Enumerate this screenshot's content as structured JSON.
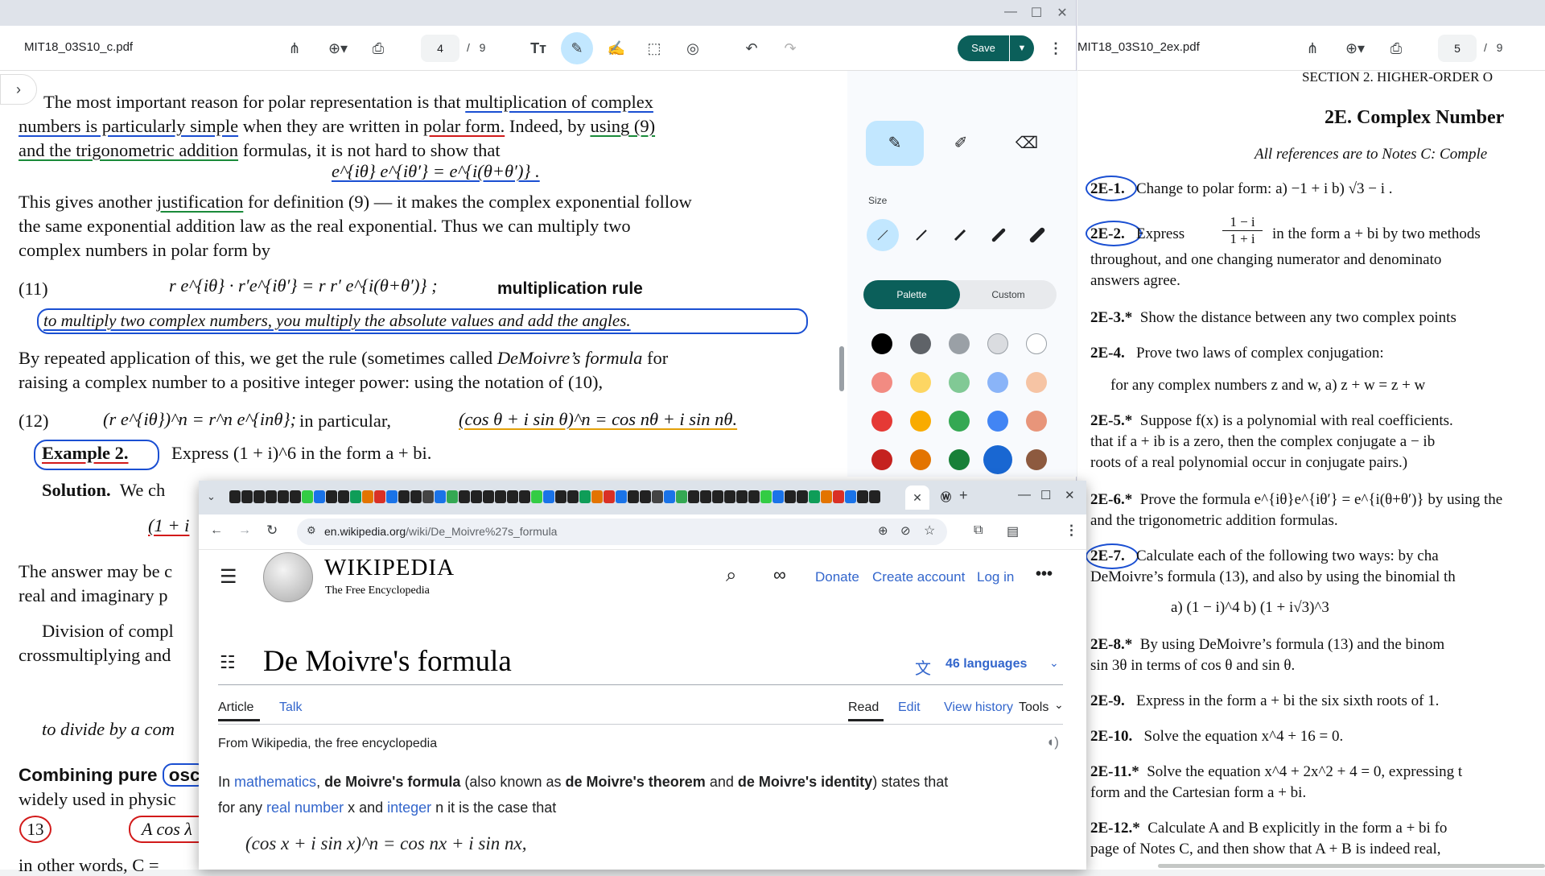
{
  "left_pdf": {
    "filename": "MIT18_03S10_c.pdf",
    "page_current": "4",
    "page_total": "9",
    "save_label": "Save",
    "lines": {
      "l1a": "The most important reason for polar representation is that ",
      "l1b": "multiplication of complex",
      "l2a": "numbers is particularly simple",
      "l2b": " when they are written in ",
      "l2c": "polar form.",
      "l2d": " Indeed, by ",
      "l2e": "using (9)",
      "l3a": "and the trigonometric addition",
      "l3b": " formulas, it is not hard to show that",
      "eq1": "e^{iθ} e^{iθ′} = e^{i(θ+θ′)} .",
      "l4a": "This gives another ",
      "l4b": "justification",
      "l4c": " for definition (9) — it makes the complex exponential follow",
      "l5": "the same exponential addition law as the real exponential.  Thus we can multiply two",
      "l6": "complex numbers in polar form by",
      "eq11_num": "(11)",
      "eq11": "r e^{iθ} · r′e^{iθ′} = r r′ e^{i(θ+θ′)} ;",
      "handwrite1": "multiplication rule",
      "boxed_rule": "to multiply two complex numbers, you multiply the absolute values and add the angles.",
      "l7a": "By repeated application of this, we get the rule (sometimes called ",
      "l7b": "DeMoivre’s formula",
      "l7c": " for",
      "l8": "raising a complex number to a positive integer power: using the notation of (10),",
      "eq12_num": "(12)",
      "eq12": "(r e^{iθ})^n = r^n e^{inθ};",
      "eq12_mid": "in particular,",
      "eq12_b": "(cos θ + i sin θ)^n = cos nθ + i sin nθ.",
      "example_label": "Example 2.",
      "example_text": "Express  (1 + i)^6  in the form  a + bi.",
      "solution_label": "Solution.",
      "solution_text": "We ch",
      "partial1": "(1 + i",
      "l9": "The answer may be c",
      "l10": "real and imaginary p",
      "l11": "Division of compl",
      "l12": "crossmultiplying and",
      "l13": "to divide by a com",
      "l14a": "Combining pure",
      "l14b": "osc",
      "l15": "widely used in physic",
      "eq13_num": "13",
      "eq13": "A cos λ",
      "l16": "in other words,  C ="
    }
  },
  "annotation_panel": {
    "size_label": "Size",
    "palette_label": "Palette",
    "custom_label": "Custom",
    "colors": [
      "#000000",
      "#5f6368",
      "#9aa0a6",
      "#dadce0",
      "#ffffff",
      "#f28b82",
      "#fdd663",
      "#81c995",
      "#8ab4f8",
      "#f6c4a4",
      "#e53935",
      "#f9ab00",
      "#34a853",
      "#4285f4",
      "#e8957a",
      "#c5221f",
      "#e37400",
      "#188038",
      "#1967d2",
      "#8d5a3f"
    ]
  },
  "right_pdf": {
    "filename": "MIT18_03S10_2ex.pdf",
    "page_current": "5",
    "page_total": "9",
    "lines": {
      "header": "SECTION 2.   HIGHER-ORDER O",
      "title": "2E.  Complex Number",
      "refs": "All references are to Notes C: Comple",
      "e1_label": "2E-1.",
      "e1": "Change to polar form:    a) −1 + i     b) √3 − i .",
      "e2_label": "2E-2.",
      "e2a": "Express",
      "e2_num": "1 − i",
      "e2_den": "1 + i",
      "e2b": "in the form a + bi by two methods",
      "e2c": "throughout, and one changing numerator and denominato",
      "e2d": "answers agree.",
      "e3_label": "2E-3.*",
      "e3": "Show the distance between any two complex points",
      "e4_label": "2E-4.",
      "e4": "Prove two laws of complex conjugation:",
      "e4b": "for any complex numbers z and w,    a)  z + w = z + w",
      "e5_label": "2E-5.*",
      "e5": "Suppose f(x) is a polynomial with real coefficients.",
      "e5b": "that if  a + ib  is a zero, then the complex conjugate  a − ib",
      "e5c": "roots of a real polynomial occur in conjugate pairs.)",
      "e6_label": "2E-6.*",
      "e6": "Prove the formula e^{iθ}e^{iθ′} = e^{i(θ+θ′)} by using the",
      "e6b": "and the trigonometric addition formulas.",
      "e7_label": "2E-7.",
      "e7": "Calculate each of the following two ways: by cha",
      "e7b": "DeMoivre’s formula (13), and also by using the binomial th",
      "e7c": "a)  (1 − i)^4          b)  (1 + i√3)^3",
      "e8_label": "2E-8.*",
      "e8": "By using DeMoivre’s formula (13) and the binom",
      "e8b": "sin 3θ in terms of cos θ and sin θ.",
      "e9_label": "2E-9.",
      "e9": "Express in the form a + bi the six sixth roots of 1.",
      "e10_label": "2E-10.",
      "e10": "Solve the equation x^4 + 16 = 0.",
      "e11_label": "2E-11.*",
      "e11": "Solve the equation x^4 + 2x^2 + 4 = 0, expressing t",
      "e11b": "form and the Cartesian form a + bi.",
      "e12_label": "2E-12.*",
      "e12": "Calculate A and B explicitly in the form a + bi fo",
      "e12b": "page of Notes C, and then show that A + B is indeed real,"
    }
  },
  "browser": {
    "url_domain": "en.wikipedia.org",
    "url_path": "/wiki/De_Moivre%27s_formula",
    "wordmark": "WIKIPEDIA",
    "tagline": "The Free Encyclopedia",
    "donate": "Donate",
    "create_account": "Create account",
    "log_in": "Log in",
    "page_title": "De Moivre's formula",
    "languages": "46 languages",
    "tab_article": "Article",
    "tab_talk": "Talk",
    "tab_read": "Read",
    "tab_edit": "Edit",
    "tab_history": "View history",
    "tab_tools": "Tools",
    "from": "From Wikipedia, the free encyclopedia",
    "p1_a": "In ",
    "p1_link1": "mathematics",
    "p1_b": ", ",
    "p1_bold1": "de Moivre's formula",
    "p1_c": " (also known as ",
    "p1_bold2": "de Moivre's theorem",
    "p1_d": " and ",
    "p1_bold3": "de Moivre's identity",
    "p1_e": ") states that",
    "p2_a": "for any ",
    "p2_link1": "real number",
    "p2_b": " x and ",
    "p2_link2": "integer",
    "p2_c": " n it is the case that",
    "formula": "(cos x + i sin x)^n = cos nx + i sin nx,"
  }
}
